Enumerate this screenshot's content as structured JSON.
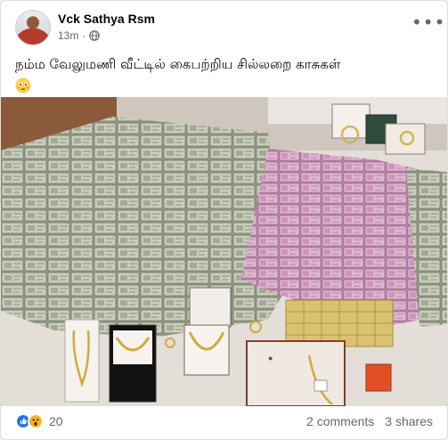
{
  "post": {
    "author": "Vck Sathya Rsm",
    "time": "13m",
    "separator": "·",
    "caption": "நம்ம வேலுமணி வீட்டில் கைபற்றிய சில்லறை காசுகள்",
    "reaction_count": "20",
    "comments": "2 comments",
    "shares": "3 shares"
  },
  "icons": {
    "privacy": "globe-icon",
    "more": "more-options-icon",
    "reactions": [
      "like-icon",
      "wow-icon"
    ],
    "caption_emoji": "flushed-face-icon"
  },
  "colors": {
    "like_blue": "#1877f2",
    "wow_yellow": "#f7b125",
    "secondary_text": "#65676b"
  }
}
